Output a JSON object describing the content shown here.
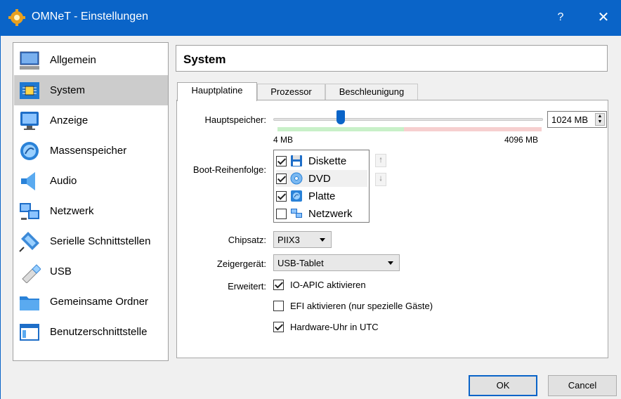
{
  "window": {
    "title": "OMNeT - Einstellungen",
    "help": "?",
    "close": "✕"
  },
  "sidebar": {
    "items": [
      {
        "label": "Allgemein",
        "icon": "general-icon"
      },
      {
        "label": "System",
        "icon": "system-chip-icon",
        "selected": true
      },
      {
        "label": "Anzeige",
        "icon": "monitor-icon"
      },
      {
        "label": "Massenspeicher",
        "icon": "storage-disk-icon"
      },
      {
        "label": "Audio",
        "icon": "speaker-icon"
      },
      {
        "label": "Netzwerk",
        "icon": "network-icon"
      },
      {
        "label": "Serielle Schnittstellen",
        "icon": "serial-port-icon"
      },
      {
        "label": "USB",
        "icon": "usb-icon"
      },
      {
        "label": "Gemeinsame Ordner",
        "icon": "folder-icon"
      },
      {
        "label": "Benutzerschnittstelle",
        "icon": "window-ui-icon"
      }
    ]
  },
  "header": {
    "title": "System"
  },
  "tabs": [
    {
      "label": "Hauptplatine",
      "active": true
    },
    {
      "label": "Prozessor"
    },
    {
      "label": "Beschleunigung"
    }
  ],
  "memory": {
    "label": "Hauptspeicher:",
    "value": "1024 MB",
    "min_label": "4 MB",
    "max_label": "4096 MB",
    "fraction": 0.25
  },
  "boot": {
    "label": "Boot-Reihenfolge:",
    "items": [
      {
        "label": "Diskette",
        "checked": true,
        "icon": "floppy-icon"
      },
      {
        "label": "DVD",
        "checked": true,
        "icon": "dvd-icon"
      },
      {
        "label": "Platte",
        "checked": true,
        "icon": "hard-disk-icon"
      },
      {
        "label": "Netzwerk",
        "checked": false,
        "icon": "network-icon"
      }
    ],
    "up": "🠕",
    "down": "🠗"
  },
  "chipset": {
    "label": "Chipsatz:",
    "value": "PIIX3"
  },
  "pointer": {
    "label": "Zeigergerät:",
    "value": "USB-Tablet"
  },
  "extended": {
    "label": "Erweitert:",
    "options": [
      {
        "label": "IO-APIC aktivieren",
        "checked": true
      },
      {
        "label": "EFI aktivieren (nur spezielle Gäste)",
        "checked": false
      },
      {
        "label": "Hardware-Uhr in UTC",
        "checked": true
      }
    ]
  },
  "buttons": {
    "ok": "OK",
    "cancel": "Cancel"
  },
  "colors": {
    "accent": "#0a64c8",
    "selected_bg": "#cccccc"
  }
}
